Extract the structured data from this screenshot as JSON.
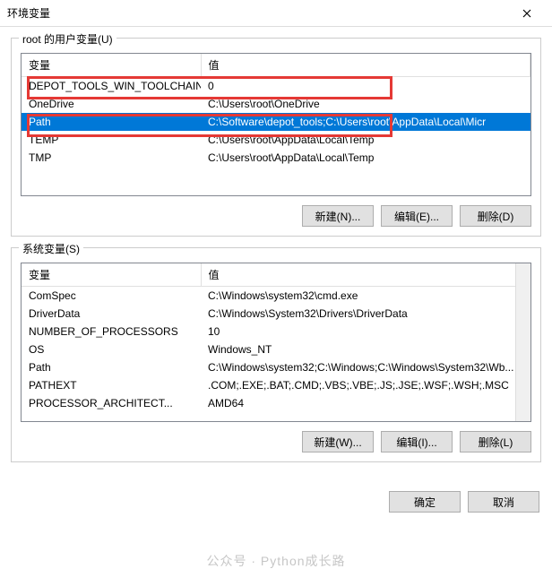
{
  "window": {
    "title": "环境变量"
  },
  "userVars": {
    "label": "root 的用户变量(U)",
    "headers": {
      "name": "变量",
      "value": "值"
    },
    "rows": [
      {
        "name": "DEPOT_TOOLS_WIN_TOOLCHAIN",
        "value": "0"
      },
      {
        "name": "OneDrive",
        "value": "C:\\Users\\root\\OneDrive"
      },
      {
        "name": "Path",
        "value": "C:\\Software\\depot_tools;C:\\Users\\root\\AppData\\Local\\Micr"
      },
      {
        "name": "TEMP",
        "value": "C:\\Users\\root\\AppData\\Local\\Temp"
      },
      {
        "name": "TMP",
        "value": "C:\\Users\\root\\AppData\\Local\\Temp"
      }
    ],
    "buttons": {
      "new": "新建(N)...",
      "edit": "编辑(E)...",
      "delete": "删除(D)"
    }
  },
  "sysVars": {
    "label": "系统变量(S)",
    "headers": {
      "name": "变量",
      "value": "值"
    },
    "rows": [
      {
        "name": "ComSpec",
        "value": "C:\\Windows\\system32\\cmd.exe"
      },
      {
        "name": "DriverData",
        "value": "C:\\Windows\\System32\\Drivers\\DriverData"
      },
      {
        "name": "NUMBER_OF_PROCESSORS",
        "value": "10"
      },
      {
        "name": "OS",
        "value": "Windows_NT"
      },
      {
        "name": "Path",
        "value": "C:\\Windows\\system32;C:\\Windows;C:\\Windows\\System32\\Wb..."
      },
      {
        "name": "PATHEXT",
        "value": ".COM;.EXE;.BAT;.CMD;.VBS;.VBE;.JS;.JSE;.WSF;.WSH;.MSC"
      },
      {
        "name": "PROCESSOR_ARCHITECT...",
        "value": "AMD64"
      }
    ],
    "buttons": {
      "new": "新建(W)...",
      "edit": "编辑(I)...",
      "delete": "删除(L)"
    }
  },
  "dialog": {
    "ok": "确定",
    "cancel": "取消"
  },
  "watermark": "公众号 · Python成长路"
}
